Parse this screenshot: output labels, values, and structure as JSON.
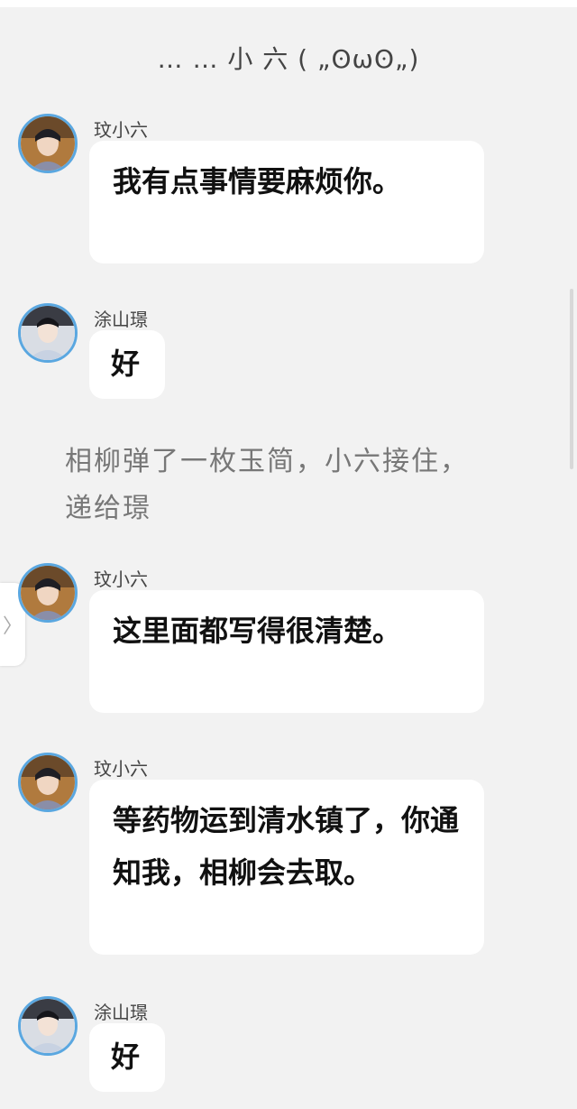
{
  "header": {
    "title": "…  … 小 六 ( „ʘωʘ„)"
  },
  "messages": [
    {
      "sender": "玟小六",
      "text": "我有点事情要麻烦你。"
    },
    {
      "sender": "涂山璟",
      "text": "好"
    },
    {
      "sender": "玟小六",
      "text": "这里面都写得很清楚。"
    },
    {
      "sender": "玟小六",
      "text": "等药物运到清水镇了，你通知我，相柳会去取。"
    },
    {
      "sender": "涂山璟",
      "text": "好"
    }
  ],
  "narration": "相柳弹了一枚玉简，小六接住，递给璟",
  "side_tab": {
    "icon": "chevron-right-icon",
    "glyph": "〉"
  },
  "colors": {
    "background": "#f2f2f2",
    "bubble": "#ffffff",
    "avatar_ring": "#5aa7e0",
    "narration": "#777777"
  }
}
